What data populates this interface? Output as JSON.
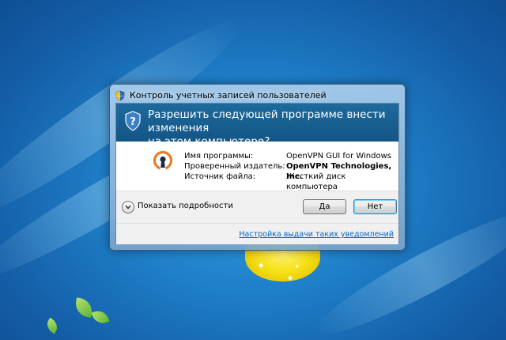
{
  "window": {
    "title": "Контроль учетных записей пользователей"
  },
  "header": {
    "question_line1": "Разрешить следующей программе внести изменения",
    "question_line2": "на этом компьютере?"
  },
  "details": {
    "program_label": "Имя программы:",
    "program_value": "OpenVPN GUI for Windows",
    "publisher_label": "Проверенный издатель:",
    "publisher_value": "OpenVPN Technologies, Inc.",
    "source_label": "Источник файла:",
    "source_value": "Жесткий диск компьютера"
  },
  "actions": {
    "show_details_label": "Показать подробности",
    "yes_label": "Да",
    "no_label": "Нет"
  },
  "footer": {
    "link_label": "Настройка выдачи таких уведомлений"
  },
  "icons": {
    "title_icon": "uac-shield-icon",
    "header_icon": "uac-shield-icon",
    "app_icon": "openvpn-icon",
    "details_toggle_icon": "chevron-down-icon"
  },
  "colors": {
    "header_bg": "#135586",
    "openvpn_orange": "#ea7b25",
    "link": "#0066cc",
    "desktop_bg": "#1f7fc8"
  }
}
